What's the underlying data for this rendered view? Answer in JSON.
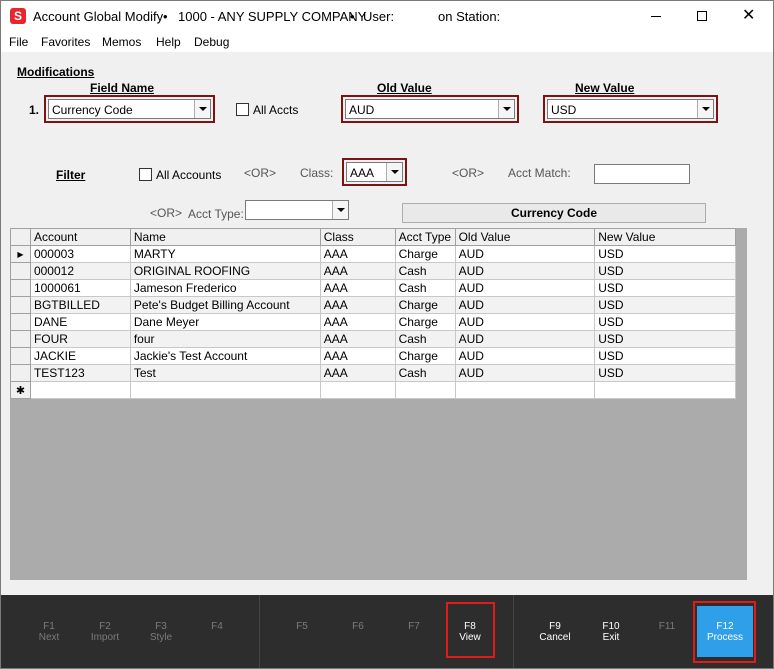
{
  "window": {
    "title_app": "Account Global Modify",
    "title_company": "1000 - ANY SUPPLY COMPANY",
    "title_user_label": "User:",
    "title_station": "on Station:",
    "bullet": "•",
    "close_glyph": "✕",
    "icon_letter": "S"
  },
  "menu": [
    "File",
    "Favorites",
    "Memos",
    "Help",
    "Debug"
  ],
  "modifications": {
    "heading": "Modifications",
    "field_name_header": "Field Name",
    "old_value_header": "Old Value",
    "new_value_header": "New Value",
    "row_number": "1.",
    "field_name_value": "Currency Code",
    "all_accts_label": "All Accts",
    "old_value": "AUD",
    "new_value": "USD"
  },
  "filter": {
    "heading": "Filter",
    "all_accounts_label": "All Accounts",
    "or_label": "<OR>",
    "class_label": "Class:",
    "class_value": "AAA",
    "acct_match_label": "Acct Match:",
    "acct_match_value": "",
    "acct_type_label": "Acct Type:",
    "acct_type_value": "",
    "field_display": "Currency Code"
  },
  "grid": {
    "columns": [
      "Account",
      "Name",
      "Class",
      "Acct Type",
      "Old Value",
      "New Value"
    ],
    "rows": [
      [
        "000003",
        "MARTY",
        "AAA",
        "Charge",
        "AUD",
        "USD"
      ],
      [
        "000012",
        "ORIGINAL ROOFING",
        "AAA",
        "Cash",
        "AUD",
        "USD"
      ],
      [
        "1000061",
        "Jameson Frederico",
        "AAA",
        "Cash",
        "AUD",
        "USD"
      ],
      [
        "BGTBILLED",
        "Pete's Budget Billing Account",
        "AAA",
        "Charge",
        "AUD",
        "USD"
      ],
      [
        "DANE",
        "Dane Meyer",
        "AAA",
        "Charge",
        "AUD",
        "USD"
      ],
      [
        "FOUR",
        "four",
        "AAA",
        "Cash",
        "AUD",
        "USD"
      ],
      [
        "JACKIE",
        "Jackie's Test Account",
        "AAA",
        "Charge",
        "AUD",
        "USD"
      ],
      [
        "TEST123",
        "Test",
        "AAA",
        "Cash",
        "AUD",
        "USD"
      ]
    ],
    "current_row_glyph": "▶",
    "new_row_glyph": "✱"
  },
  "function_keys": [
    {
      "key": "F1",
      "label": "Next",
      "enabled": false
    },
    {
      "key": "F2",
      "label": "Import",
      "enabled": false
    },
    {
      "key": "F3",
      "label": "Style",
      "enabled": false
    },
    {
      "key": "F4",
      "label": "",
      "enabled": false
    },
    {
      "key": "F5",
      "label": "",
      "enabled": false
    },
    {
      "key": "F6",
      "label": "",
      "enabled": false
    },
    {
      "key": "F7",
      "label": "",
      "enabled": false
    },
    {
      "key": "F8",
      "label": "View",
      "enabled": true
    },
    {
      "key": "F9",
      "label": "Cancel",
      "enabled": true
    },
    {
      "key": "F10",
      "label": "Exit",
      "enabled": true
    },
    {
      "key": "F11",
      "label": "",
      "enabled": false
    },
    {
      "key": "F12",
      "label": "Process",
      "enabled": true
    }
  ],
  "colors": {
    "highlight_box": "#7a1414",
    "f12_accent": "#2e9fe8",
    "red_annotation": "#e11a1a",
    "function_bar": "#2d2d2d"
  }
}
